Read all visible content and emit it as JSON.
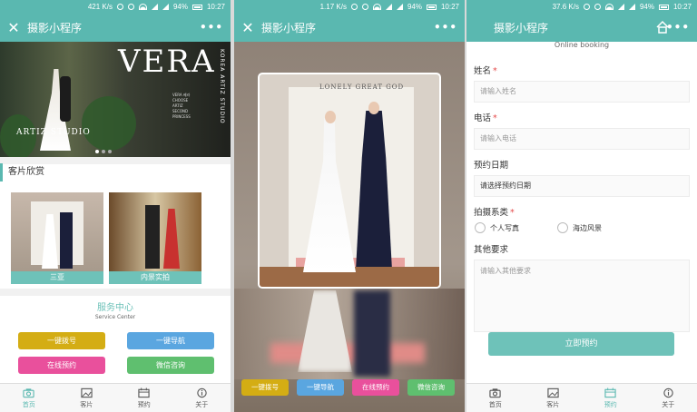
{
  "panels": [
    {
      "status": {
        "speed": "421 K/s",
        "battery": "94%",
        "time": "10:27"
      },
      "nav": {
        "title": "摄影小程序",
        "close_glyph": "✕",
        "more_glyph": "•••"
      },
      "banner": {
        "brand": "VERA",
        "brand_sub": "KOREA ARTIZ STUDIO",
        "studio": "ARTIZ STUDIO",
        "lines": [
          "VERA 베라",
          "CHOOSE",
          "ARTIZ",
          "SECOND",
          "PRINCESS"
        ]
      },
      "gallery": {
        "heading": "客片欣赏",
        "cards": [
          {
            "caption": "三亚"
          },
          {
            "caption": "内景实拍"
          }
        ]
      },
      "service": {
        "title": "服务中心",
        "subtitle": "Service Center",
        "buttons": [
          "一键拨号",
          "一键导航",
          "在线预约",
          "微信咨询"
        ]
      },
      "tabs": [
        {
          "label": "首页",
          "icon": "camera-icon",
          "active": true
        },
        {
          "label": "客片",
          "icon": "image-icon",
          "active": false
        },
        {
          "label": "预约",
          "icon": "calendar-icon",
          "active": false
        },
        {
          "label": "关于",
          "icon": "info-icon",
          "active": false
        }
      ]
    },
    {
      "status": {
        "speed": "1.17 K/s",
        "battery": "94%",
        "time": "10:27"
      },
      "nav": {
        "title": "摄影小程序",
        "close_glyph": "✕",
        "more_glyph": "•••"
      },
      "photo_text": "LONELY GREAT GOD",
      "buttons": [
        "一键拨号",
        "一键导航",
        "在线预约",
        "微信咨询"
      ]
    },
    {
      "status": {
        "speed": "37.6 K/s",
        "battery": "94%",
        "time": "10:27"
      },
      "nav": {
        "title": "摄影小程序",
        "more_glyph": "•••"
      },
      "online_booking": "Online booking",
      "form": {
        "name_label": "姓名",
        "name_placeholder": "请输入姓名",
        "phone_label": "电话",
        "phone_placeholder": "请输入电话",
        "date_label": "预约日期",
        "date_value": "请选择预约日期",
        "series_label": "拍摄系类",
        "options": [
          "个人写真",
          "海边风景"
        ],
        "other_label": "其他要求",
        "other_placeholder": "请输入其他要求",
        "required_mark": "*",
        "submit": "立即预约"
      },
      "tabs": [
        {
          "label": "首页",
          "icon": "camera-icon",
          "active": false
        },
        {
          "label": "客片",
          "icon": "image-icon",
          "active": false
        },
        {
          "label": "预约",
          "icon": "calendar-icon",
          "active": true
        },
        {
          "label": "关于",
          "icon": "info-icon",
          "active": false
        }
      ]
    }
  ],
  "colors": {
    "primary": "#5ab8b0",
    "yellow": "#d4ad14",
    "blue": "#5aa6e0",
    "pink": "#e9509c",
    "green": "#5fbf6f",
    "required": "#e54a4a"
  }
}
